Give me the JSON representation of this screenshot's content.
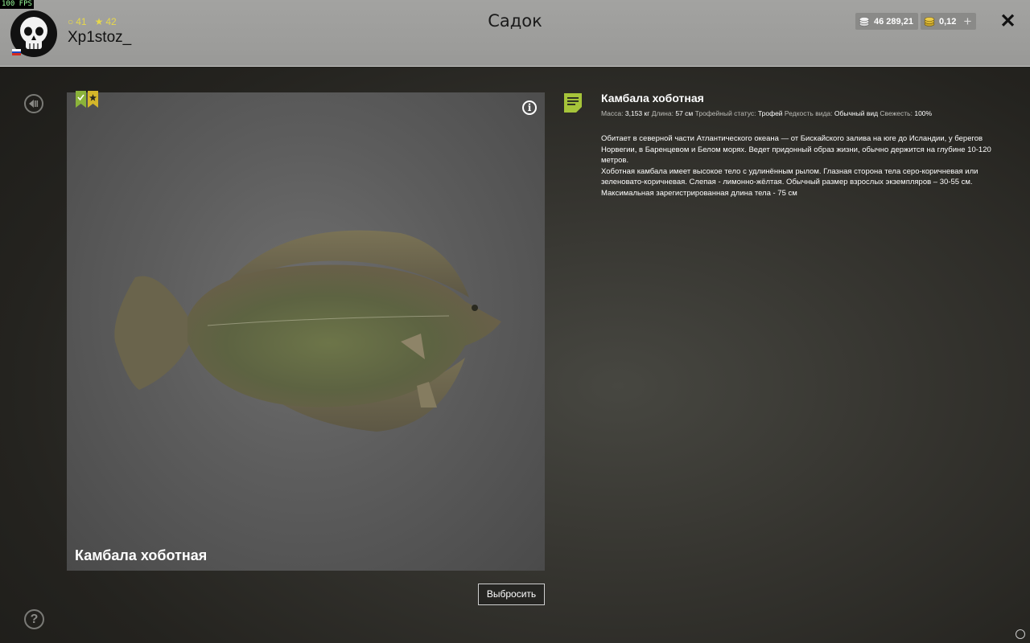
{
  "fps": "100 FPS",
  "header": {
    "title": "Садок",
    "username": "Xp1stoz_",
    "level": "41",
    "rating": "42",
    "silver": "46 289,21",
    "gold": "0,12",
    "plus_label": "+",
    "close_label": "✕"
  },
  "fish": {
    "name": "Камбала хоботная",
    "caption": "Камбала хоботная",
    "stats": {
      "mass_label": "Масса:",
      "mass_value": "3,153 кг",
      "length_label": "Длина:",
      "length_value": "57 см",
      "trophy_label": "Трофейный статус:",
      "trophy_value": "Трофей",
      "rarity_label": "Редкость вида:",
      "rarity_value": "Обычный вид",
      "fresh_label": "Свежесть:",
      "fresh_value": "100%"
    },
    "description_1": "Обитает в северной части Атлантического океана — от Бискайского залива на юге до Исландии, у берегов Норвегии, в Баренцевом и Белом морях. Ведет придонный образ жизни, обычно держится на глубине 10-120 метров.",
    "description_2": "Хоботная камбала имеет высокое тело с удлинённым рылом. Глазная сторона тела серо-коричневая или зеленовато-коричневая. Слепая - лимонно-жёлтая. Обычный размер взрослых экземпляров – 30-55 см. Максимальная зарегистрированная длина тела - 75 см"
  },
  "buttons": {
    "discard": "Выбросить",
    "help": "?",
    "info": "i"
  },
  "colors": {
    "accent_green": "#a6c43a",
    "accent_yellow": "#e7d84a"
  }
}
